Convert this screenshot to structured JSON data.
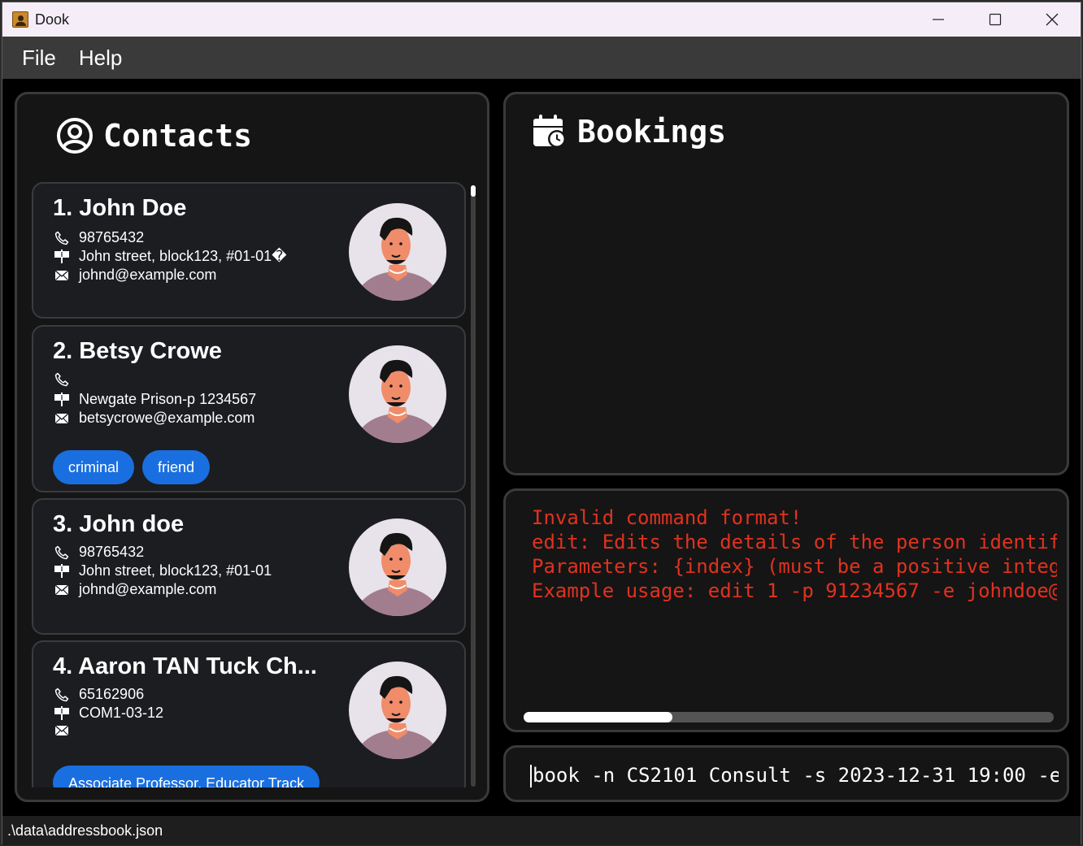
{
  "window": {
    "title": "Dook",
    "controls": [
      "minimize",
      "maximize",
      "close"
    ]
  },
  "menu": {
    "items": [
      "File",
      "Help"
    ]
  },
  "contacts": {
    "title": "Contacts",
    "icon": "user-circle-icon",
    "list": [
      {
        "index_name": "1. John Doe",
        "phone": "98765432",
        "address": "John street, block123, #01-01�",
        "email": "johnd@example.com",
        "tags": []
      },
      {
        "index_name": "2. Betsy Crowe",
        "phone": "",
        "address": "Newgate Prison-p 1234567",
        "email": "betsycrowe@example.com",
        "tags": [
          "criminal",
          "friend"
        ]
      },
      {
        "index_name": "3. John doe",
        "phone": "98765432",
        "address": "John street, block123, #01-01",
        "email": "johnd@example.com",
        "tags": []
      },
      {
        "index_name": "4. Aaron TAN Tuck Ch...",
        "phone": "65162906",
        "address": "COM1-03-12",
        "email": "",
        "tags": [
          "Associate Professor, Educator Track"
        ]
      }
    ]
  },
  "bookings": {
    "title": "Bookings",
    "icon": "calendar-clock-icon"
  },
  "result": {
    "lines": [
      "Invalid command format!",
      "edit: Edits the details of the person identif",
      "Parameters: {index} (must be a positive integ",
      "Example usage: edit 1 -p 91234567 -e johndoe@"
    ],
    "scroll_fraction": 0.28
  },
  "command": {
    "value": "book -n CS2101 Consult -s 2023-12-31 19:00 -e"
  },
  "status": {
    "path": ".\\data\\addressbook.json"
  },
  "colors": {
    "accent": "#1a6fe0",
    "error_text": "#e0321f",
    "panel_bg": "#151515",
    "card_bg": "#1c1d21"
  }
}
